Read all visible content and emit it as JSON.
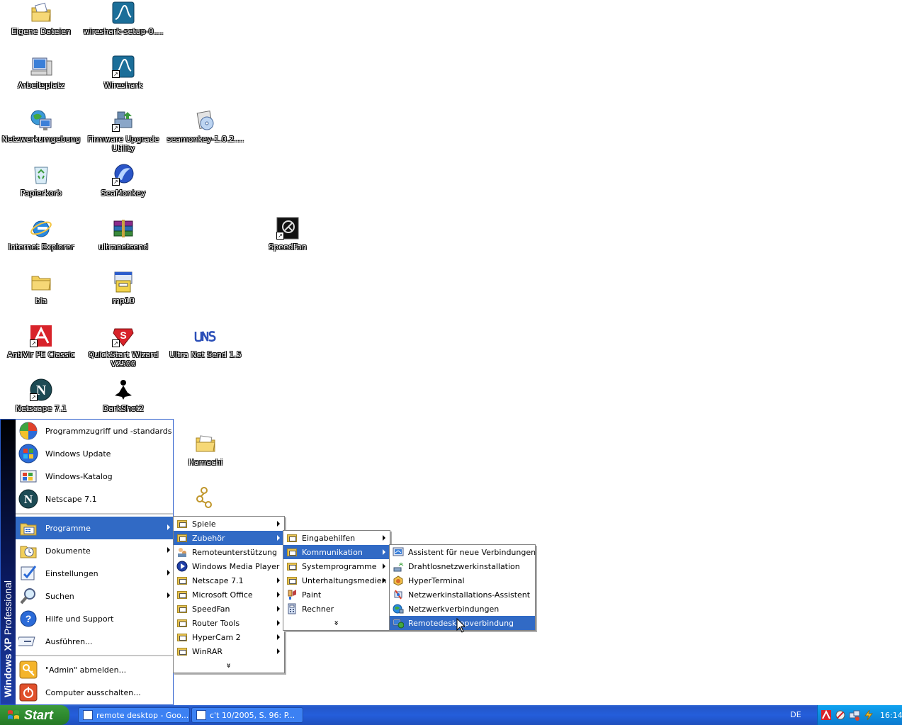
{
  "desktop": {
    "icons": [
      {
        "label": "Eigene Dateien",
        "icon": "my-documents-icon"
      },
      {
        "label": "wireshark-setup-0....",
        "icon": "wireshark-icon"
      },
      {
        "label": "Arbeitsplatz",
        "icon": "my-computer-icon"
      },
      {
        "label": "Wireshark",
        "icon": "wireshark-icon"
      },
      {
        "label": "Netzwerkumgebung",
        "icon": "network-places-icon"
      },
      {
        "label": "Firmware Upgrade Utility",
        "icon": "firmware-icon"
      },
      {
        "label": "seamonkey-1.0.2....",
        "icon": "installer-icon"
      },
      {
        "label": "Papierkorb",
        "icon": "recycle-bin-icon"
      },
      {
        "label": "SeaMonkey",
        "icon": "seamonkey-icon"
      },
      {
        "label": "Internet Explorer",
        "icon": "internet-explorer-icon"
      },
      {
        "label": "ultranetsend",
        "icon": "winrar-archive-icon"
      },
      {
        "label": "SpeedFan",
        "icon": "speedfan-icon"
      },
      {
        "label": "bla",
        "icon": "folder-icon"
      },
      {
        "label": "mp10",
        "icon": "setup-icon"
      },
      {
        "label": "AntiVir PE Classic",
        "icon": "antivir-icon"
      },
      {
        "label": "QuickStart Wizard V2500",
        "icon": "quickstart-icon"
      },
      {
        "label": "Ultra Net Send 1.5",
        "icon": "uns-icon"
      },
      {
        "label": "Netscape 7.1",
        "icon": "netscape-icon"
      },
      {
        "label": "DarkShot2",
        "icon": "darkshot-icon"
      },
      {
        "label": "Hamachi",
        "icon": "folder-icon"
      },
      {
        "label": "",
        "icon": "hamachi-icon"
      }
    ]
  },
  "start_menu": {
    "banner": {
      "brand": "Windows XP",
      "edition": "Professional"
    },
    "pinned": [
      {
        "label": "Programmzugriff und -standards",
        "icon": "program-access-icon"
      },
      {
        "label": "Windows Update",
        "icon": "windows-update-icon"
      },
      {
        "label": "Windows-Katalog",
        "icon": "windows-catalog-icon"
      },
      {
        "label": "Netscape 7.1",
        "icon": "netscape-icon"
      }
    ],
    "main": [
      {
        "label": "Programme",
        "icon": "programs-icon",
        "submenu": true
      },
      {
        "label": "Dokumente",
        "icon": "documents-icon",
        "submenu": true
      },
      {
        "label": "Einstellungen",
        "icon": "settings-icon",
        "submenu": true
      },
      {
        "label": "Suchen",
        "icon": "search-icon",
        "submenu": true
      },
      {
        "label": "Hilfe und Support",
        "icon": "help-icon",
        "submenu": false
      },
      {
        "label": "Ausführen...",
        "icon": "run-icon",
        "submenu": false
      }
    ],
    "bottom": [
      {
        "label": "\"Admin\" abmelden...",
        "icon": "logoff-icon"
      },
      {
        "label": "Computer ausschalten...",
        "icon": "shutdown-icon"
      }
    ]
  },
  "programs_menu": {
    "items": [
      {
        "label": "Spiele",
        "submenu": true
      },
      {
        "label": "Zubehör",
        "submenu": true
      },
      {
        "label": "Remoteunterstützung",
        "submenu": false
      },
      {
        "label": "Windows Media Player",
        "submenu": false
      },
      {
        "label": "Netscape 7.1",
        "submenu": true
      },
      {
        "label": "Microsoft Office",
        "submenu": true
      },
      {
        "label": "SpeedFan",
        "submenu": true
      },
      {
        "label": "Router Tools",
        "submenu": true
      },
      {
        "label": "HyperCam 2",
        "submenu": true
      },
      {
        "label": "WinRAR",
        "submenu": true
      }
    ],
    "more": "»"
  },
  "accessories_menu": {
    "items": [
      {
        "label": "Eingabehilfen",
        "submenu": true
      },
      {
        "label": "Kommunikation",
        "submenu": true
      },
      {
        "label": "Systemprogramme",
        "submenu": true
      },
      {
        "label": "Unterhaltungsmedien",
        "submenu": true
      },
      {
        "label": "Paint",
        "submenu": false
      },
      {
        "label": "Rechner",
        "submenu": false
      }
    ],
    "more": "»"
  },
  "communication_menu": {
    "items": [
      {
        "label": "Assistent für neue Verbindungen"
      },
      {
        "label": "Drahtlosnetzwerkinstallation"
      },
      {
        "label": "HyperTerminal"
      },
      {
        "label": "Netzwerkinstallations-Assistent"
      },
      {
        "label": "Netzwerkverbindungen"
      },
      {
        "label": "Remotedesktopverbindung"
      }
    ]
  },
  "taskbar": {
    "start_label": "Start",
    "tasks": [
      {
        "label": "remote desktop - Goo..."
      },
      {
        "label": "c't 10/2005, S. 96: P..."
      }
    ],
    "language": "DE",
    "clock": "16:14"
  },
  "colors": {
    "selection": "#316ac5",
    "taskbar": "#245edb",
    "start_button": "#2f8b2f",
    "tray": "#0d8fdf"
  }
}
